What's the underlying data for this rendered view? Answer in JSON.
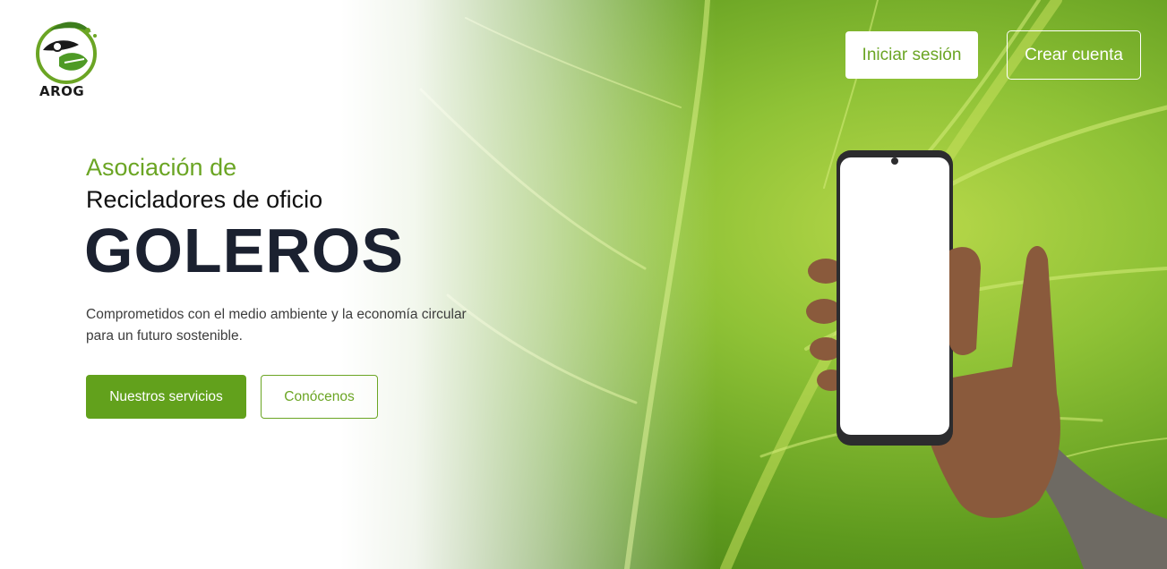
{
  "brand": {
    "logo_text": "AROG",
    "logo_icon": "eagle-recycle-logo"
  },
  "header": {
    "login_label": "Iniciar sesión",
    "signup_label": "Crear cuenta"
  },
  "hero": {
    "pre_title": "Asociación de",
    "sub_title": "Recicladores de oficio",
    "title": "GOLEROS",
    "description_line1": "Comprometidos con el medio ambiente y la economía circular",
    "description_line2": "para un futuro sostenible.",
    "primary_button": "Nuestros servicios",
    "secondary_button": "Conócenos"
  },
  "colors": {
    "accent_green": "#62a11c",
    "title_dark": "#1b2130",
    "text_green": "#6ba524"
  },
  "images": {
    "background": "green-leaf-macro",
    "foreground": "hand-holding-phone-icon"
  }
}
